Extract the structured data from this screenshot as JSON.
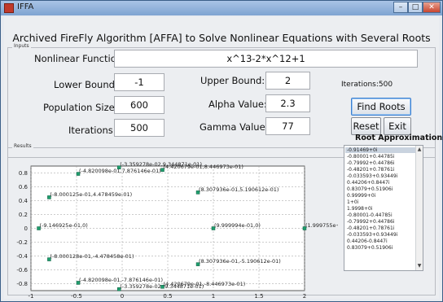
{
  "window": {
    "title": "IFFA",
    "min": "–",
    "max": "□",
    "close": "✕"
  },
  "main_title": "Archived FireFly Algorithm [AFFA] to Solve Nonlinear Equations with Several Roots",
  "inputs": {
    "group_label": "Inputs",
    "function_label": "Nonlinear Function:",
    "function_value": "x^13-2*x^12+1",
    "lower_label": "Lower Bound:",
    "lower_value": "-1",
    "upper_label": "Upper Bound:",
    "upper_value": "2",
    "pop_label": "Population Size:",
    "pop_value": "600",
    "alpha_label": "Alpha Value:",
    "alpha_value": "2.3",
    "iter_label": "Iterations:",
    "iter_value": "500",
    "gamma_label": "Gamma Value:",
    "gamma_value": "77",
    "iter_status": "Iterations:500",
    "find_button": "Find Roots",
    "reset_button": "Reset",
    "exit_button": "Exit"
  },
  "results": {
    "group_label": "Results",
    "roots_title": "Root Approximations",
    "roots": [
      "-0.91469+0i",
      "-0.80001+0.44785i",
      "-0.79992+0.44786i",
      "-0.48201+0.78761i",
      "-0.033593+0.93449i",
      "0.44206+0.8447i",
      "0.83079+0.51906i",
      "0.99999+0i",
      "1+0i",
      "1.9998+0i",
      "-0.80001-0.44785i",
      "-0.79992+0.44786i",
      "-0.48201+0.78761i",
      "-0.033593+0.93449i",
      "0.44206-0.8447i",
      "0.83079+0.51906i"
    ]
  },
  "chart_data": {
    "type": "scatter",
    "xlim": [
      -1,
      2
    ],
    "ylim": [
      -0.9,
      0.9
    ],
    "xticks": [
      "-1",
      "-0.5",
      "0",
      "0.5",
      "1",
      "1.5",
      "2"
    ],
    "yticks": [
      "0.8",
      "0.6",
      "0.4",
      "0.2",
      "0",
      "-0.2",
      "-0.4",
      "-0.6",
      "-0.8"
    ],
    "grid": true,
    "marker_color": "#1f9e6e",
    "points": [
      {
        "x": -0.91469,
        "y": 0,
        "label": "(-9.146925e-01,0)"
      },
      {
        "x": -0.80001,
        "y": 0.44785,
        "label": "(-8.000125e-01,4.478459e-01)"
      },
      {
        "x": -0.80001,
        "y": -0.44785,
        "label": "(-8.000128e-01,-4.478458e-01)"
      },
      {
        "x": -0.48201,
        "y": 0.78761,
        "label": "(-4.820098e-01,7.876146e-01)"
      },
      {
        "x": -0.48201,
        "y": -0.78761,
        "label": "(-4.820098e-01,-7.876146e-01)"
      },
      {
        "x": -0.033593,
        "y": 0.93449,
        "label": "(-3.359278e-02,9.344871e-01)"
      },
      {
        "x": -0.033593,
        "y": -0.93449,
        "label": "(-3.359278e-02,-9.344871e-01)"
      },
      {
        "x": 0.44206,
        "y": 0.8447,
        "label": "(4.420679e-01,8.446973e-01)"
      },
      {
        "x": 0.44206,
        "y": -0.8447,
        "label": "(4.420679e-01,-8.446973e-01)"
      },
      {
        "x": 0.83079,
        "y": 0.51906,
        "label": "(8.307936e-01,5.190612e-01)"
      },
      {
        "x": 0.83079,
        "y": -0.51906,
        "label": "(8.307936e-01,-5.190612e-01)"
      },
      {
        "x": 0.99999,
        "y": 0,
        "label": "(9.999994e-01,0)"
      },
      {
        "x": 1.9998,
        "y": 0,
        "label": "(1.999755e+0"
      }
    ]
  }
}
